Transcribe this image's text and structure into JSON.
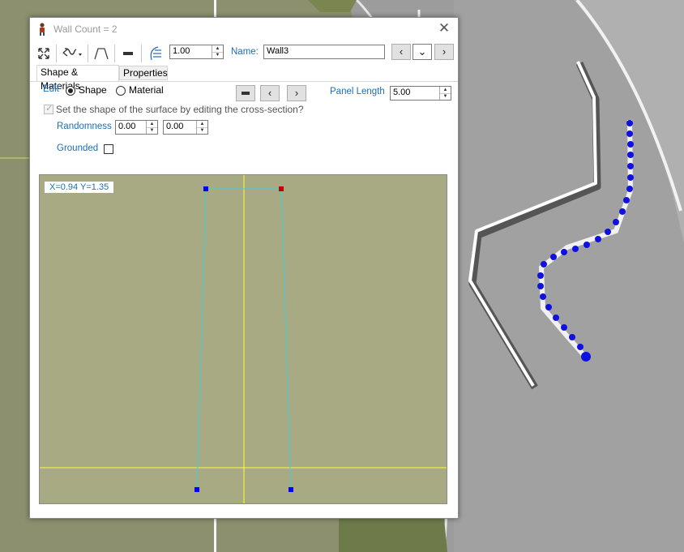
{
  "window": {
    "title": "Wall Count = 2"
  },
  "toolbar": {
    "height_value": "1.00",
    "name_label": "Name:",
    "name_value": "Wall3"
  },
  "tabs": [
    {
      "label": "Shape & Materials"
    },
    {
      "label": "Properties"
    }
  ],
  "edit": {
    "label": "Edit",
    "shape_label": "Shape",
    "material_label": "Material",
    "selected": "Shape"
  },
  "panel_length": {
    "label": "Panel Length",
    "value": "5.00"
  },
  "surface_checkbox": {
    "label": "Set the shape of the surface by editing the cross-section?",
    "checked": true,
    "enabled": false
  },
  "randomness": {
    "label": "Randomness",
    "value1": "0.00",
    "value2": "0.00"
  },
  "grounded": {
    "label": "Grounded",
    "checked": false
  },
  "canvas": {
    "coord_readout": "X=0.94 Y=1.35"
  },
  "colors": {
    "accent_text": "#1a6fb8",
    "canvas_bg": "#a7aa82",
    "axis": "#ffff30",
    "profile_line": "#40d0d8",
    "point": "#0000ff",
    "selected_point": "#c00000"
  },
  "icons": [
    "app-figure-icon",
    "move-icon",
    "curve-tool-icon",
    "profile-tool-icon",
    "flat-panel-icon",
    "ramp-tool-icon",
    "chevron-left-icon",
    "chevron-down-icon",
    "chevron-right-icon",
    "close-icon"
  ]
}
